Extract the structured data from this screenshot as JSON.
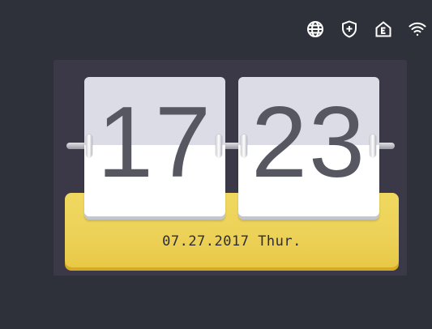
{
  "status_bar": {
    "icons": [
      "globe-icon",
      "shield-plus-icon",
      "home-e-icon",
      "wifi-icon"
    ]
  },
  "clock": {
    "hour": "17",
    "minute": "23"
  },
  "date": {
    "text": "07.27.2017 Thur."
  },
  "colors": {
    "background": "#2f313a",
    "panel": "#3b3947",
    "date_bar": "#ecd157",
    "digit": "#575761"
  }
}
